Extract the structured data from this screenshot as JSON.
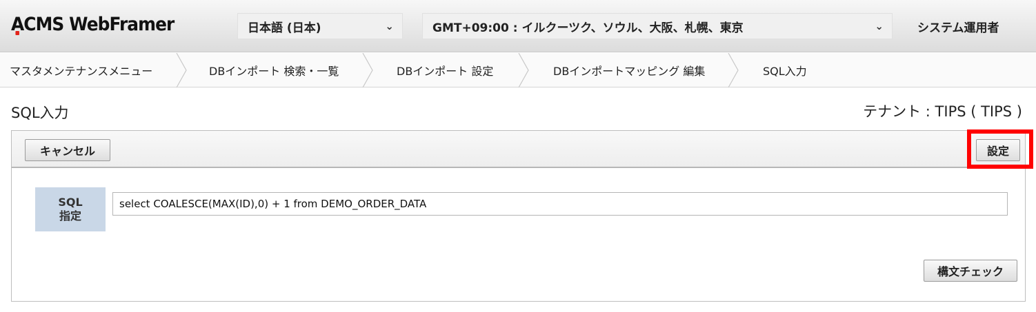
{
  "header": {
    "logo": "ACMS WebFramer",
    "language": "日本語 (日本)",
    "timezone": "GMT+09:00 : イルクーツク、ソウル、大阪、札幌、東京",
    "user": "システム運用者",
    "accent_color": "#e2231a"
  },
  "breadcrumb": [
    "マスタメンテナンスメニュー",
    "DBインポート 検索・一覧",
    "DBインポート 設定",
    "DBインポートマッピング 編集",
    "SQL入力"
  ],
  "page": {
    "title": "SQL入力",
    "tenant": "テナント : TIPS ( TIPS )"
  },
  "toolbar": {
    "cancel_label": "キャンセル",
    "setting_label": "設定",
    "highlight_color": "#ff0000"
  },
  "form": {
    "sql_label_line1": "SQL",
    "sql_label_line2": "指定",
    "sql_value": "select COALESCE(MAX(ID),0) + 1 from DEMO_ORDER_DATA",
    "syntax_check_label": "構文チェック"
  },
  "icons": {
    "select_chevron": "chevron-down-icon",
    "breadcrumb_separator": "chevron-right-icon"
  }
}
